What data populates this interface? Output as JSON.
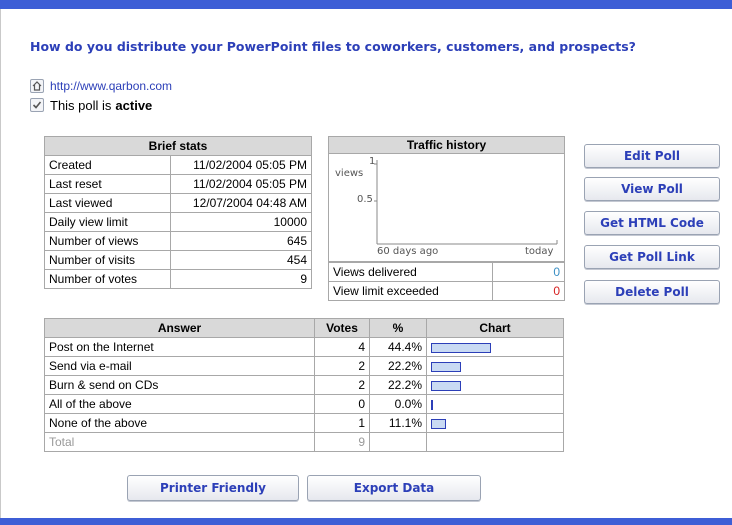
{
  "question": "How do you distribute your PowerPoint files to coworkers, customers, and prospects?",
  "url": "http://www.qarbon.com",
  "status": {
    "prefix": "This poll is",
    "value": "active"
  },
  "brief_stats": {
    "title": "Brief stats",
    "rows": [
      {
        "label": "Created",
        "value": "11/02/2004 05:05 PM"
      },
      {
        "label": "Last reset",
        "value": "11/02/2004 05:05 PM"
      },
      {
        "label": "Last viewed",
        "value": "12/07/2004 04:48 AM"
      },
      {
        "label": "Daily view limit",
        "value": "10000"
      },
      {
        "label": "Number of views",
        "value": "645"
      },
      {
        "label": "Number of visits",
        "value": "454"
      },
      {
        "label": "Number of votes",
        "value": "9"
      }
    ]
  },
  "traffic": {
    "title": "Traffic history",
    "y_top": "1",
    "y_unit": "views",
    "y_mid": "0.5",
    "x_left": "60 days ago",
    "x_right": "today",
    "delivered_label": "Views delivered",
    "delivered_value": "0",
    "delivered_color": "#3a8fc4",
    "exceeded_label": "View limit exceeded",
    "exceeded_value": "0",
    "exceeded_color": "#d62020"
  },
  "buttons": {
    "edit": "Edit Poll",
    "view": "View Poll",
    "html": "Get HTML Code",
    "link": "Get Poll Link",
    "delete": "Delete Poll",
    "printer": "Printer Friendly",
    "export": "Export Data"
  },
  "answers": {
    "headers": {
      "answer": "Answer",
      "votes": "Votes",
      "pct": "%",
      "chart": "Chart"
    },
    "rows": [
      {
        "answer": "Post on the Internet",
        "votes": "4",
        "pct": "44.4%",
        "share": 0.444
      },
      {
        "answer": "Send via e-mail",
        "votes": "2",
        "pct": "22.2%",
        "share": 0.222
      },
      {
        "answer": "Burn & send on CDs",
        "votes": "2",
        "pct": "22.2%",
        "share": 0.222
      },
      {
        "answer": "All of the above",
        "votes": "0",
        "pct": "0.0%",
        "share": 0.0
      },
      {
        "answer": "None of the above",
        "votes": "1",
        "pct": "11.1%",
        "share": 0.111
      }
    ],
    "total_label": "Total",
    "total_votes": "9"
  },
  "colors": {
    "accent": "#3d5ed6",
    "link": "#2c3fb8",
    "bar_fill": "#c9daf3"
  }
}
